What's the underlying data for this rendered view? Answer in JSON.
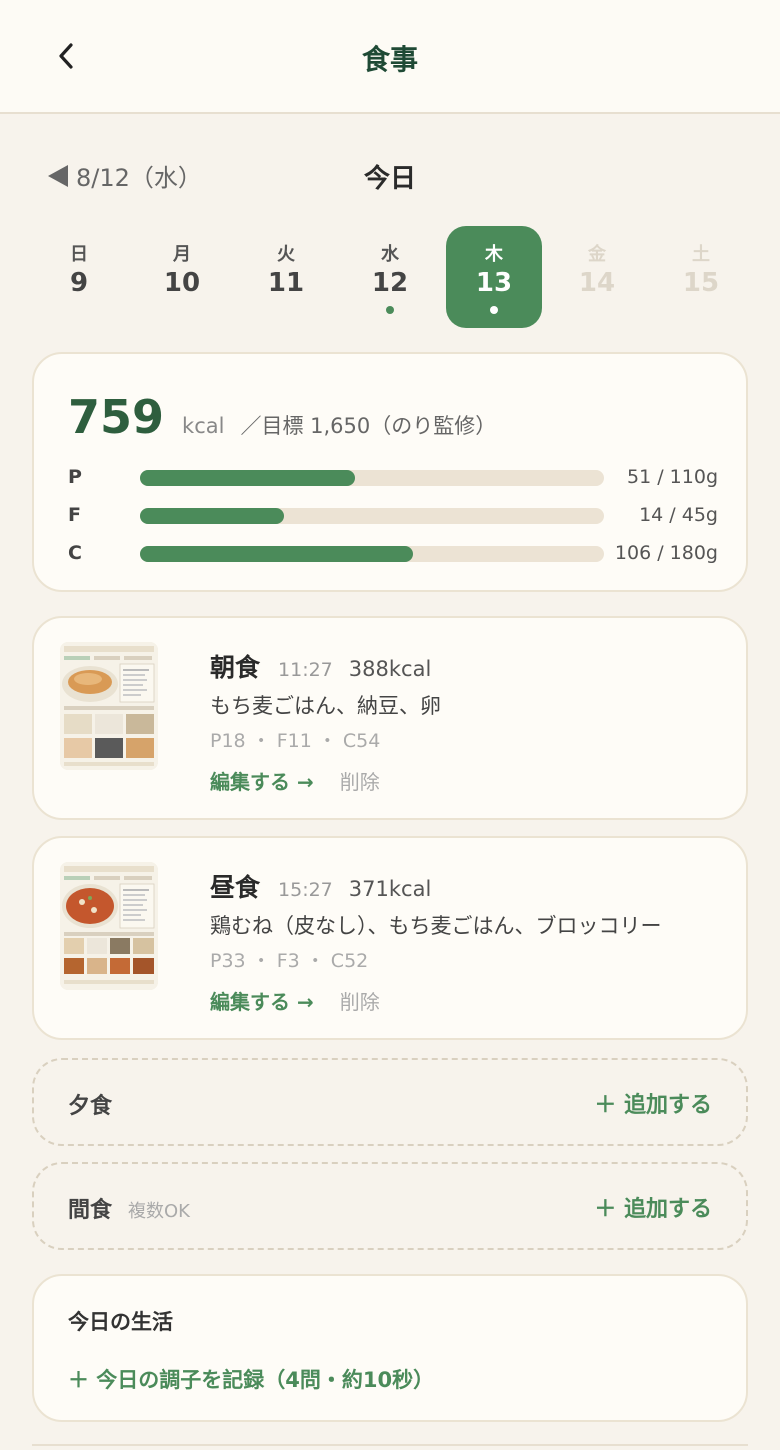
{
  "header": {
    "title": "食事",
    "back_icon": "chevron-left-icon"
  },
  "date_nav": {
    "prev_label": "8/12（水）",
    "current_label": "今日"
  },
  "week": [
    {
      "dow": "日",
      "num": "9",
      "state": "past",
      "has_record": false
    },
    {
      "dow": "月",
      "num": "10",
      "state": "past",
      "has_record": false
    },
    {
      "dow": "火",
      "num": "11",
      "state": "past",
      "has_record": false
    },
    {
      "dow": "水",
      "num": "12",
      "state": "past",
      "has_record": true
    },
    {
      "dow": "木",
      "num": "13",
      "state": "selected",
      "has_record": true
    },
    {
      "dow": "金",
      "num": "14",
      "state": "future",
      "has_record": false
    },
    {
      "dow": "土",
      "num": "15",
      "state": "future",
      "has_record": false
    }
  ],
  "summary": {
    "kcal": "759",
    "kcal_unit": "kcal",
    "goal": "／目標 1,650（のり監修）",
    "macros": [
      {
        "label": "P",
        "value": "51 / 110g",
        "fraction": 0.4636
      },
      {
        "label": "F",
        "value": "14 / 45g",
        "fraction": 0.3111
      },
      {
        "label": "C",
        "value": "106 / 180g",
        "fraction": 0.5889
      }
    ]
  },
  "meals": [
    {
      "name": "朝食",
      "time": "11:27",
      "kcal": "388kcal",
      "foods": "もち麦ごはん、納豆、卵",
      "pfc": "P18 ・ F11 ・ C54",
      "edit_label": "編集する →",
      "delete_label": "削除"
    },
    {
      "name": "昼食",
      "time": "15:27",
      "kcal": "371kcal",
      "foods": "鶏むね（皮なし）、もち麦ごはん、ブロッコリー",
      "pfc": "P33 ・ F3 ・ C52",
      "edit_label": "編集する →",
      "delete_label": "削除"
    }
  ],
  "empty_slots": [
    {
      "name": "夕食",
      "sub": "",
      "add_label": "＋ 追加する"
    },
    {
      "name": "間食",
      "sub": "複数OK",
      "add_label": "＋ 追加する"
    }
  ],
  "life": {
    "title": "今日の生活",
    "record_label": "＋ 今日の調子を記録（4問・約10秒）"
  },
  "colors": {
    "accent": "#4b8b5a",
    "title": "#1f4a35",
    "background": "#f7f3ec"
  }
}
